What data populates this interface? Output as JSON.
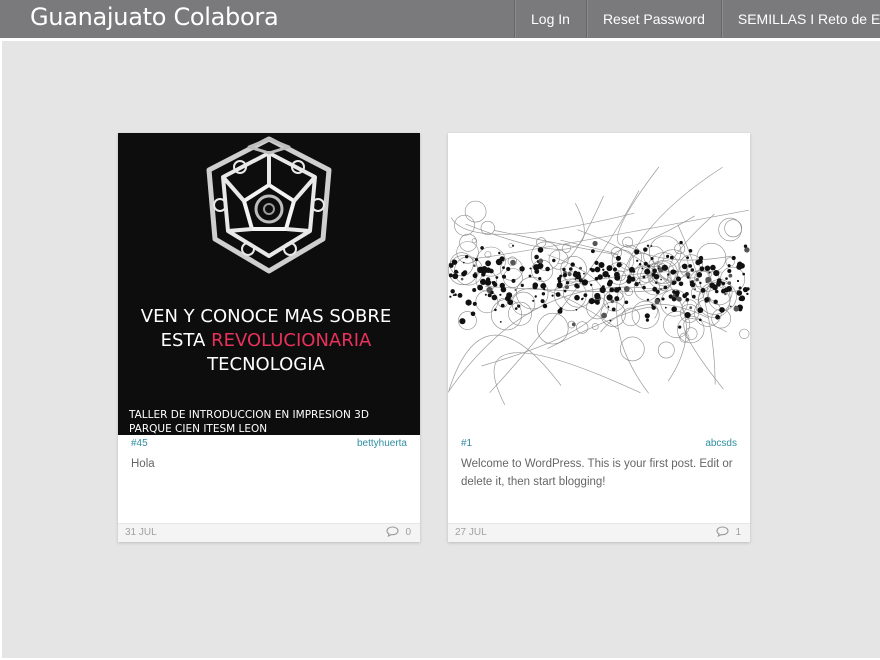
{
  "header": {
    "site_title": "Guanajuato Colabora",
    "nav": [
      {
        "label": "Log In"
      },
      {
        "label": "Reset Password"
      },
      {
        "label": "SEMILLAS I Reto de E"
      }
    ]
  },
  "posts": [
    {
      "poster": {
        "line1": "VEN Y CONOCE MAS SOBRE",
        "line2_prefix": "ESTA ",
        "line2_highlight": "REVOLUCIONARIA",
        "line3": "TECNOLOGIA",
        "footer1": "TALLER DE INTRODUCCION EN  IMPRESION 3D",
        "footer2": "PARQUE CIEN ITESM LEON",
        "highlight_color": "#e8315b"
      },
      "number": "#45",
      "author": "bettyhuerta",
      "excerpt": "Hola",
      "date": "31 JUL",
      "comments": "0"
    },
    {
      "number": "#1",
      "author": "abcsds",
      "excerpt": "Welcome to WordPress. This is your first post. Edit or delete it, then start blogging!",
      "date": "27 JUL",
      "comments": "1"
    }
  ],
  "colors": {
    "topbar": "#7a7a7c",
    "background": "#e5e5e5",
    "link": "#2f8ea0"
  }
}
